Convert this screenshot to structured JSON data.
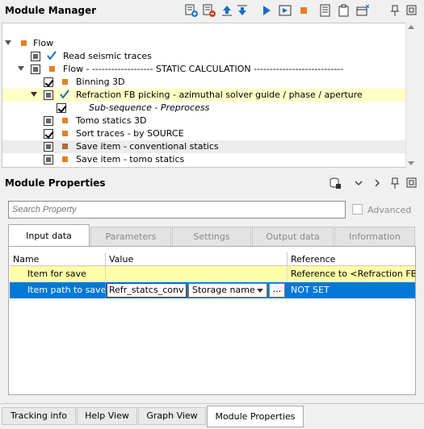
{
  "module_manager": {
    "title": "Module Manager",
    "toolbar_icons": [
      "add-module-icon",
      "remove-module-icon",
      "move-up-icon",
      "move-down-icon",
      "run-icon",
      "step-run-icon",
      "stop-icon",
      "list-icon",
      "clipboard-icon",
      "dock-options-icon",
      "pin-icon",
      "float-icon"
    ],
    "tree": {
      "rows": [
        {
          "label": "Flow",
          "indent": 0,
          "expanded": true,
          "marker": "orange"
        },
        {
          "label": "Read seismic traces",
          "checkbox": "grayed",
          "tick": true
        },
        {
          "label": "Flow - ------------------- STATIC CALCULATION ----------------------------",
          "expanded": true,
          "checkbox": "grayed",
          "marker": "orange"
        },
        {
          "label": "Binning 3D",
          "checkbox": "checked",
          "marker": "orange"
        },
        {
          "label": "Refraction FB picking - azimuthal solver guide / phase / aperture",
          "expanded": true,
          "checkbox": "grayed",
          "tick": true,
          "highlight": "yellow"
        },
        {
          "label": "Sub-sequence - Preprocess",
          "checkbox": "checked",
          "italic": true
        },
        {
          "label": "Tomo statics 3D",
          "checkbox": "grayed",
          "marker": "orange"
        },
        {
          "label": "Sort traces - by SOURCE",
          "checkbox": "checked",
          "marker": "orange"
        },
        {
          "label": "Save item - conventional statics",
          "checkbox": "grayed",
          "marker": "brown",
          "highlight": "gray"
        },
        {
          "label": "Save item - tomo statics",
          "checkbox": "grayed",
          "marker": "orange"
        }
      ]
    }
  },
  "module_properties": {
    "title": "Module Properties",
    "header_icons": [
      "database-icon",
      "chevron-left-icon",
      "chevron-right-icon",
      "pin-icon",
      "float-icon"
    ],
    "search": {
      "placeholder": "Search Property"
    },
    "advanced_label": "Advanced",
    "tabs": [
      "Input data",
      "Parameters",
      "Settings",
      "Output data",
      "Information"
    ],
    "active_tab": "Input data",
    "grid": {
      "headers": [
        "Name",
        "Value",
        "Reference"
      ],
      "rows": [
        {
          "name": "Item for save",
          "value": "",
          "reference": "Reference to <Refraction FB p"
        },
        {
          "name": "Item path to save",
          "value": "Refr_statcs_conv",
          "combo": "Storage name",
          "button": "...",
          "reference": "NOT SET"
        }
      ]
    }
  },
  "bottom_tabs": [
    "Tracking info",
    "Help View",
    "Graph View",
    "Module Properties"
  ],
  "bottom_active": "Module Properties",
  "colors": {
    "accent_blue": "#0078d7",
    "highlight_yellow": "#ffffc6",
    "marker_orange": "#e67e22",
    "marker_brown": "#b5653a"
  }
}
